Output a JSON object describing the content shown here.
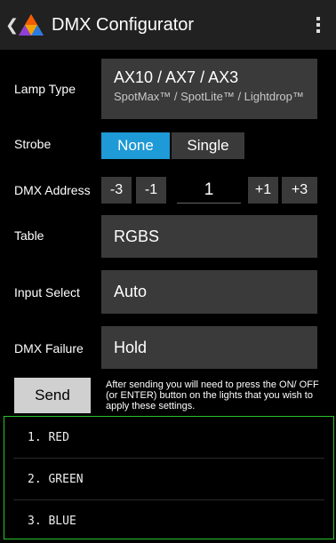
{
  "app": {
    "title": "DMX Configurator"
  },
  "lamp_type": {
    "label": "Lamp Type",
    "value": "AX10 / AX7 / AX3",
    "subtitle": "SpotMax™ / SpotLite™ / Lightdrop™"
  },
  "strobe": {
    "label": "Strobe",
    "options": [
      "None",
      "Single"
    ],
    "selected": "None"
  },
  "dmx_address": {
    "label": "DMX Address",
    "value": "1",
    "buttons": [
      "-3",
      "-1",
      "+1",
      "+3"
    ]
  },
  "table": {
    "label": "Table",
    "value": "RGBS"
  },
  "input_select": {
    "label": "Input Select",
    "value": "Auto"
  },
  "dmx_failure": {
    "label": "DMX Failure",
    "value": "Hold"
  },
  "send": {
    "label": "Send",
    "note": "After sending you will need to press the ON/ OFF (or ENTER) button on the lights that you wish to apply these settings."
  },
  "list": {
    "items": [
      "1. RED",
      "2. GREEN",
      "3. BLUE"
    ]
  },
  "colors": {
    "accent": "#1e9ad6",
    "list_border": "#2bc22b",
    "field_bg": "#3a3a3a"
  },
  "icons": {
    "back": "chevron-left-icon",
    "logo": "triangle-logo",
    "menu": "more-vert-icon"
  }
}
